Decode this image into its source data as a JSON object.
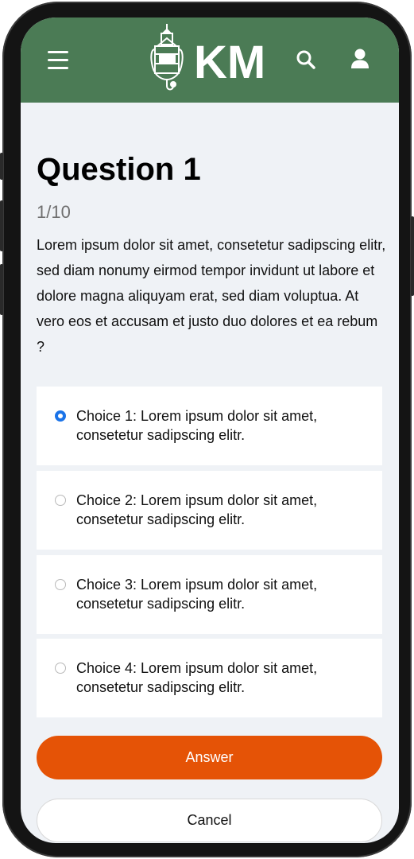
{
  "header": {
    "logo_text": "KM",
    "menu_icon": "hamburger-menu-icon",
    "search_icon": "search-icon",
    "user_icon": "user-icon",
    "color": "#4b7b55"
  },
  "question": {
    "title": "Question 1",
    "counter": "1/10",
    "text": "Lorem ipsum dolor sit amet, consetetur sadipscing elitr, sed diam nonumy eirmod tempor invidunt ut labore et dolore magna aliquyam erat, sed diam voluptua. At vero eos et accusam et justo duo dolores et ea rebum ?"
  },
  "choices": [
    {
      "label": "Choice 1: Lorem ipsum dolor sit amet, consetetur sadipscing elitr.",
      "selected": true
    },
    {
      "label": "Choice 2: Lorem ipsum dolor sit amet, consetetur sadipscing elitr.",
      "selected": false
    },
    {
      "label": "Choice 3: Lorem ipsum dolor sit amet, consetetur sadipscing elitr.",
      "selected": false
    },
    {
      "label": "Choice 4: Lorem ipsum dolor sit amet, consetetur sadipscing elitr.",
      "selected": false
    }
  ],
  "actions": {
    "answer_label": "Answer",
    "cancel_label": "Cancel",
    "answer_color": "#e55306"
  }
}
